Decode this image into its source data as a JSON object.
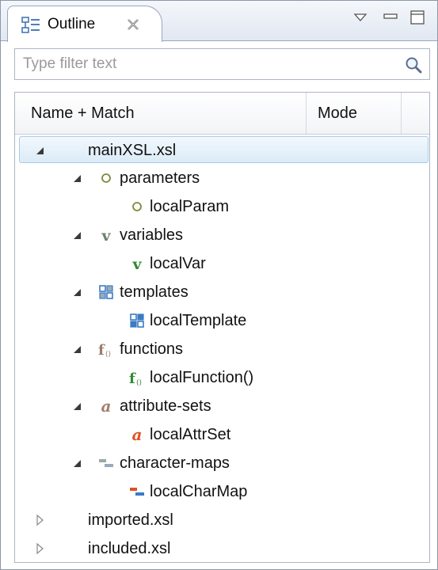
{
  "view": {
    "title": "Outline",
    "close_icon": "close-x-icon",
    "controls": [
      "view-menu-icon",
      "minimize-icon",
      "maximize-icon"
    ]
  },
  "filter": {
    "placeholder": "Type filter text",
    "value": "",
    "icon": "search-icon"
  },
  "table": {
    "columns": [
      "Name + Match",
      "Mode"
    ],
    "rows": [
      {
        "label": "mainXSL.xsl",
        "level": 0,
        "expanded": true,
        "selected": true,
        "icon": ""
      },
      {
        "label": "parameters",
        "level": 1,
        "expanded": true,
        "icon": "param-circle-icon"
      },
      {
        "label": "localParam",
        "level": 2,
        "icon": "param-circle-icon"
      },
      {
        "label": "variables",
        "level": 1,
        "expanded": true,
        "icon": "variable-v-icon"
      },
      {
        "label": "localVar",
        "level": 2,
        "icon": "variable-v-icon"
      },
      {
        "label": "templates",
        "level": 1,
        "expanded": true,
        "icon": "template-icon"
      },
      {
        "label": "localTemplate",
        "level": 2,
        "icon": "template-icon"
      },
      {
        "label": "functions",
        "level": 1,
        "expanded": true,
        "icon": "function-icon"
      },
      {
        "label": "localFunction()",
        "level": 2,
        "icon": "function-icon"
      },
      {
        "label": "attribute-sets",
        "level": 1,
        "expanded": true,
        "icon": "attribute-set-icon"
      },
      {
        "label": "localAttrSet",
        "level": 2,
        "icon": "attribute-set-icon"
      },
      {
        "label": "character-maps",
        "level": 1,
        "expanded": true,
        "icon": "character-map-icon"
      },
      {
        "label": "localCharMap",
        "level": 2,
        "icon": "character-map-icon"
      },
      {
        "label": "imported.xsl",
        "level": 0,
        "expanded": false,
        "icon": ""
      },
      {
        "label": "included.xsl",
        "level": 0,
        "expanded": false,
        "icon": ""
      }
    ]
  },
  "colors": {
    "selection": "#dcebf7",
    "selection_border": "#a9cbe8",
    "variable": "#2e8b2e",
    "function": "#2e8b2e",
    "attribute_set": "#e0521f",
    "template": "#3b7bc4",
    "char_map": "#3b7bc4"
  }
}
